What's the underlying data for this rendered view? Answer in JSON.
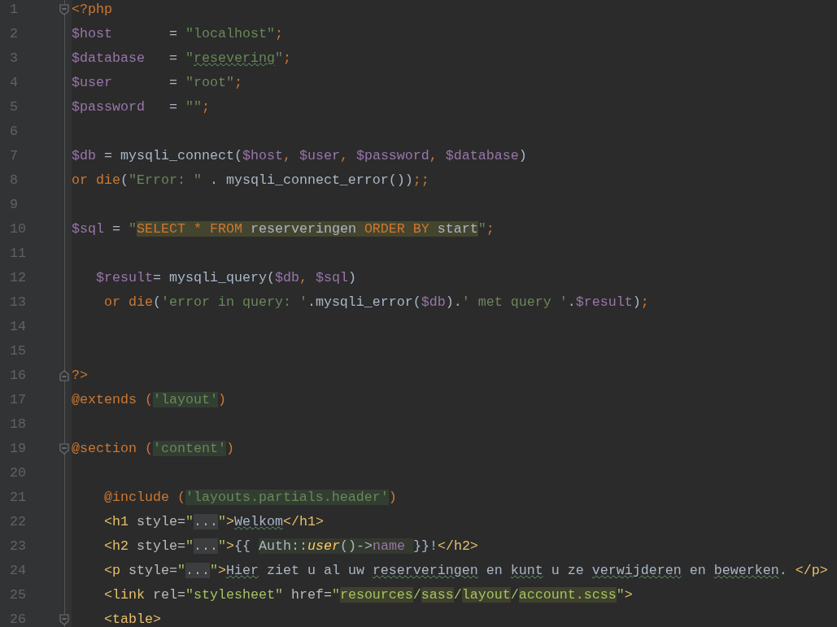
{
  "editor": {
    "lines": [
      {
        "number": "1",
        "fold_start": true,
        "tokens": [
          {
            "kind": "kw",
            "text": "<?php"
          }
        ]
      },
      {
        "number": "2",
        "tokens": [
          {
            "kind": "var",
            "text": "$host"
          },
          {
            "kind": "plain",
            "text": "       = "
          },
          {
            "kind": "str",
            "text": "\"localhost\""
          },
          {
            "kind": "kw",
            "text": ";"
          }
        ]
      },
      {
        "number": "3",
        "tokens": [
          {
            "kind": "var",
            "text": "$database"
          },
          {
            "kind": "plain",
            "text": "   = "
          },
          {
            "kind": "str",
            "text": "\""
          },
          {
            "kind": "str-typo",
            "text": "resevering"
          },
          {
            "kind": "str",
            "text": "\""
          },
          {
            "kind": "kw",
            "text": ";"
          }
        ]
      },
      {
        "number": "4",
        "tokens": [
          {
            "kind": "var",
            "text": "$user"
          },
          {
            "kind": "plain",
            "text": "       = "
          },
          {
            "kind": "str",
            "text": "\"root\""
          },
          {
            "kind": "kw",
            "text": ";"
          }
        ]
      },
      {
        "number": "5",
        "tokens": [
          {
            "kind": "var",
            "text": "$password"
          },
          {
            "kind": "plain",
            "text": "   = "
          },
          {
            "kind": "str",
            "text": "\"\""
          },
          {
            "kind": "kw",
            "text": ";"
          }
        ]
      },
      {
        "number": "6"
      },
      {
        "number": "7",
        "tokens": [
          {
            "kind": "var",
            "text": "$db"
          },
          {
            "kind": "plain",
            "text": " = mysqli_connect("
          },
          {
            "kind": "var",
            "text": "$host"
          },
          {
            "kind": "kw",
            "text": ", "
          },
          {
            "kind": "var",
            "text": "$user"
          },
          {
            "kind": "kw",
            "text": ", "
          },
          {
            "kind": "var",
            "text": "$password"
          },
          {
            "kind": "kw",
            "text": ", "
          },
          {
            "kind": "var",
            "text": "$database"
          },
          {
            "kind": "plain",
            "text": ")"
          }
        ]
      },
      {
        "number": "8",
        "tokens": [
          {
            "kind": "kw",
            "text": "or die"
          },
          {
            "kind": "plain",
            "text": "("
          },
          {
            "kind": "str",
            "text": "\"Error: \""
          },
          {
            "kind": "plain",
            "text": " . mysqli_connect_error())"
          },
          {
            "kind": "kw",
            "text": ";;"
          }
        ]
      },
      {
        "number": "9"
      },
      {
        "number": "10",
        "tokens": [
          {
            "kind": "var",
            "text": "$sql"
          },
          {
            "kind": "plain",
            "text": " = "
          },
          {
            "kind": "str",
            "text": "\""
          },
          {
            "kind": "sql-kw",
            "text": "SELECT * FROM"
          },
          {
            "kind": "sql-text",
            "text": " reserveringen "
          },
          {
            "kind": "sql-kw",
            "text": "ORDER BY"
          },
          {
            "kind": "sql-text",
            "text": " start"
          },
          {
            "kind": "str",
            "text": "\""
          },
          {
            "kind": "kw",
            "text": ";"
          }
        ]
      },
      {
        "number": "11"
      },
      {
        "number": "12",
        "tokens": [
          {
            "kind": "var",
            "text": "   $result"
          },
          {
            "kind": "plain",
            "text": "= mysqli_query("
          },
          {
            "kind": "var",
            "text": "$db"
          },
          {
            "kind": "kw",
            "text": ", "
          },
          {
            "kind": "var",
            "text": "$sql"
          },
          {
            "kind": "plain",
            "text": ")"
          }
        ]
      },
      {
        "number": "13",
        "tokens": [
          {
            "kind": "kw",
            "text": "    or die"
          },
          {
            "kind": "plain",
            "text": "("
          },
          {
            "kind": "str",
            "text": "'error in query: '"
          },
          {
            "kind": "plain",
            "text": ".mysqli_error("
          },
          {
            "kind": "var",
            "text": "$db"
          },
          {
            "kind": "plain",
            "text": ")."
          },
          {
            "kind": "str",
            "text": "' met query '"
          },
          {
            "kind": "plain",
            "text": "."
          },
          {
            "kind": "var",
            "text": "$result"
          },
          {
            "kind": "plain",
            "text": ")"
          },
          {
            "kind": "kw",
            "text": ";"
          }
        ]
      },
      {
        "number": "14"
      },
      {
        "number": "15"
      },
      {
        "number": "16",
        "fold_end": true,
        "tokens": [
          {
            "kind": "kw",
            "text": "?>"
          }
        ]
      },
      {
        "number": "17",
        "tokens": [
          {
            "kind": "kw",
            "text": "@extends ("
          },
          {
            "kind": "blade-str",
            "text": "'layout'"
          },
          {
            "kind": "kw",
            "text": ")"
          }
        ]
      },
      {
        "number": "18"
      },
      {
        "number": "19",
        "fold_start": true,
        "tokens": [
          {
            "kind": "kw",
            "text": "@section ("
          },
          {
            "kind": "blade-str",
            "text": "'content'"
          },
          {
            "kind": "kw",
            "text": ")"
          }
        ]
      },
      {
        "number": "20"
      },
      {
        "number": "21",
        "tokens": [
          {
            "kind": "kw",
            "text": "    @include ("
          },
          {
            "kind": "blade-str",
            "text": "'layouts.partials.header'"
          },
          {
            "kind": "kw",
            "text": ")"
          }
        ]
      },
      {
        "number": "22",
        "tokens": [
          {
            "kind": "tag",
            "text": "    <h1 "
          },
          {
            "kind": "attr",
            "text": "style="
          },
          {
            "kind": "attrval",
            "text": "\""
          },
          {
            "kind": "ell",
            "text": "..."
          },
          {
            "kind": "attrval",
            "text": "\""
          },
          {
            "kind": "tag",
            "text": ">"
          },
          {
            "kind": "text-typo",
            "text": "Welkom"
          },
          {
            "kind": "tag",
            "text": "</h1>"
          }
        ]
      },
      {
        "number": "23",
        "tokens": [
          {
            "kind": "tag",
            "text": "    <h2 "
          },
          {
            "kind": "attr",
            "text": "style="
          },
          {
            "kind": "attrval",
            "text": "\""
          },
          {
            "kind": "ell",
            "text": "..."
          },
          {
            "kind": "attrval",
            "text": "\""
          },
          {
            "kind": "tag",
            "text": ">"
          },
          {
            "kind": "plain",
            "text": "{{ "
          },
          {
            "kind": "blade-plain",
            "text": "Auth::"
          },
          {
            "kind": "blade-fn",
            "text": "user"
          },
          {
            "kind": "blade-plain",
            "text": "()->"
          },
          {
            "kind": "blade-prop",
            "text": "name "
          },
          {
            "kind": "plain",
            "text": "}}!"
          },
          {
            "kind": "tag",
            "text": "</h2>"
          }
        ]
      },
      {
        "number": "24",
        "tokens": [
          {
            "kind": "tag",
            "text": "    <p "
          },
          {
            "kind": "attr",
            "text": "style="
          },
          {
            "kind": "attrval",
            "text": "\""
          },
          {
            "kind": "ell",
            "text": "..."
          },
          {
            "kind": "attrval",
            "text": "\""
          },
          {
            "kind": "tag",
            "text": ">"
          },
          {
            "kind": "text-typo",
            "text": "Hier"
          },
          {
            "kind": "plain",
            "text": " ziet u al uw "
          },
          {
            "kind": "text-typo",
            "text": "reserveringen"
          },
          {
            "kind": "plain",
            "text": " en "
          },
          {
            "kind": "text-typo",
            "text": "kunt"
          },
          {
            "kind": "plain",
            "text": " u ze "
          },
          {
            "kind": "text-typo",
            "text": "verwijderen"
          },
          {
            "kind": "plain",
            "text": " en "
          },
          {
            "kind": "text-typo",
            "text": "bewerken"
          },
          {
            "kind": "plain",
            "text": ". "
          },
          {
            "kind": "tag",
            "text": "</p>"
          }
        ]
      },
      {
        "number": "25",
        "tokens": [
          {
            "kind": "tag",
            "text": "    <link "
          },
          {
            "kind": "attr",
            "text": "rel="
          },
          {
            "kind": "attrval",
            "text": "\"stylesheet\" "
          },
          {
            "kind": "attr",
            "text": "href="
          },
          {
            "kind": "attrval",
            "text": "\""
          },
          {
            "kind": "path",
            "text": "resources"
          },
          {
            "kind": "attrval",
            "text": "/"
          },
          {
            "kind": "path",
            "text": "sass"
          },
          {
            "kind": "attrval",
            "text": "/"
          },
          {
            "kind": "path",
            "text": "layout"
          },
          {
            "kind": "attrval",
            "text": "/"
          },
          {
            "kind": "path",
            "text": "account.scss"
          },
          {
            "kind": "attrval",
            "text": "\""
          },
          {
            "kind": "tag",
            "text": ">"
          }
        ]
      },
      {
        "number": "26",
        "fold_start": true,
        "tokens": [
          {
            "kind": "tag",
            "text": "    <table>"
          }
        ]
      }
    ]
  }
}
